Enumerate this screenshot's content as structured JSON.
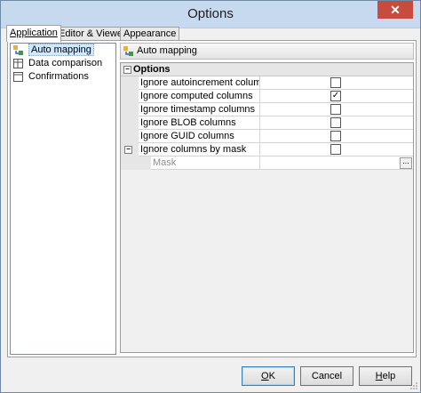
{
  "window": {
    "title": "Options",
    "close_glyph": "✕"
  },
  "tabs": [
    {
      "label": "Application",
      "active": true
    },
    {
      "label": "Editor & Viewers",
      "active": false
    },
    {
      "label": "Appearance",
      "active": false
    }
  ],
  "sidebar": {
    "items": [
      {
        "label": "Auto mapping",
        "selected": true,
        "icon": "auto-mapping-icon"
      },
      {
        "label": "Data comparison",
        "selected": false,
        "icon": "data-comparison-icon"
      },
      {
        "label": "Confirmations",
        "selected": false,
        "icon": "confirmations-icon"
      }
    ]
  },
  "pane": {
    "header": "Auto mapping",
    "category": "Options",
    "rows": [
      {
        "label": "Ignore autoincrement columns",
        "checked": false
      },
      {
        "label": "Ignore computed columns",
        "checked": true
      },
      {
        "label": "Ignore timestamp columns",
        "checked": false
      },
      {
        "label": "Ignore BLOB columns",
        "checked": false
      },
      {
        "label": "Ignore GUID columns",
        "checked": false
      },
      {
        "label": "Ignore columns by mask",
        "checked": false
      }
    ],
    "sub_row": {
      "label": "Mask",
      "value": ""
    },
    "check_mark": "✓",
    "expander": "−",
    "ellipsis": "..."
  },
  "buttons": {
    "ok": {
      "mnemonic": "O",
      "rest": "K"
    },
    "cancel": "Cancel",
    "help": {
      "mnemonic": "H",
      "rest": "elp"
    }
  },
  "colors": {
    "titlebar": "#c6d9ee",
    "close": "#c74b3e",
    "selection": "#cde8ff"
  }
}
